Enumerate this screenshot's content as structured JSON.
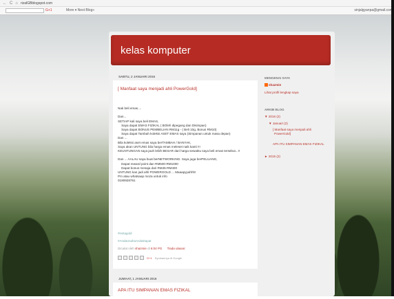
{
  "browser": {
    "url": "rizalGBblogspot.com"
  },
  "bar": {
    "g_label": "G+1",
    "more_label": "More ▾ Next Blog»",
    "user": "sinjalgyanpa@gmail.com"
  },
  "blog": {
    "title": "kelas komputer"
  },
  "post1": {
    "date": "SABTU, 2 JANUARI 2016",
    "title": "[ Manfaat saya menjadi ahli PowerGold]",
    "lines": [
      "Nak beli emas....",
      "",
      "Dan...",
      "SETIAP kali saya beli EMAS,",
      "    Saya dapat EMAS FIZIKAL ( BOleh dipegang dan Disimpan)",
      "    Saya dapat BONUS PEMBELIAN RM11g - ( Beli 10g, Bonus RM10)",
      "    Saya dapat Tambah koleksi ASET EMAS saya (Simpanan untuk masa depan)",
      "Dan ...",
      "Bila koleksi aset emas saya berTAMBAH / BANYAK,",
      "Saya akan UNTUNG bila harga emas meleset naik kanti !!!",
      "KEUNTUNGAN saya jauh lebih BESAR dari harga sewaktu saya beli emas tersebut...!!",
      "",
      "Dan ... AALAU saya buat berNETWORKING. Saya juga berPELUANG,",
      "    Dapat reward point dan RM500-RM1000",
      "    Dapat bonus mesaja dari RM45-RM400",
      "UNTUNG kan jadi ahli POWERGOLD ... Maaapyyahhh!",
      "Pm atau whatsaap moza untuk info",
      "0190928761"
    ],
    "tag1": "#instagold",
    "tag2": "#AndaUsahaAndaDapat",
    "meta_prefix": "Dicatat oleh",
    "author": "shazmie",
    "time": "6:04 PG",
    "comments": "Tiada ulasan:",
    "share_text": "Syorkannya di Google"
  },
  "post2": {
    "date": "JUMAAT, 1 JANUARI 2016",
    "title": "APA ITU SIMPANAN EMAS FIZIKAL"
  },
  "sidebar": {
    "about_head": "MENGENAI SAYA",
    "name": "shazmie",
    "profile_link": "Lihat profil lengkap saya",
    "archive_head": "ARKIB BLOG",
    "y2016": "▼ 2016 (2)",
    "jan": "▼ Januari (2)",
    "post_a1": "[ Manfaat saya menjadi ahli",
    "post_a2": "PowerGold]",
    "post_b": "APA ITU SIMPANAN EMAS FIZIKAL",
    "y2015": "► 2015 (2)"
  },
  "colors": {
    "header": "#b62c24",
    "link": "#b8322a"
  }
}
